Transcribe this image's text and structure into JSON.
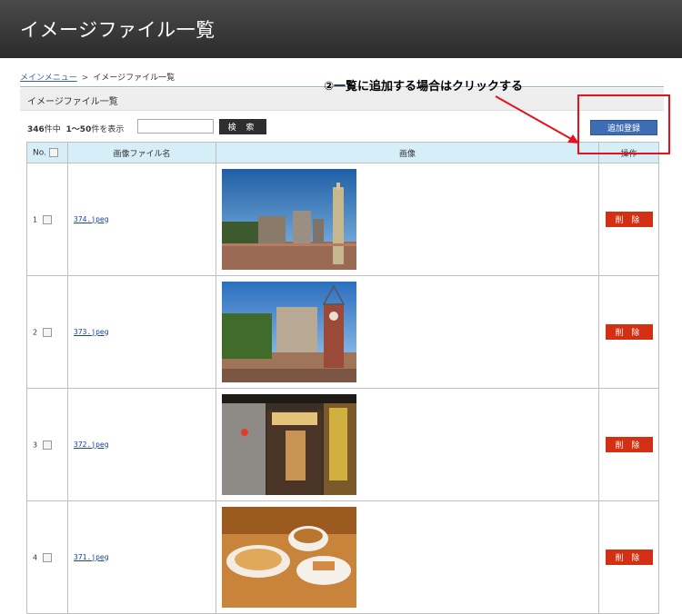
{
  "header": {
    "title": "イメージファイル一覧"
  },
  "breadcrumb": {
    "home": "メインメニュー",
    "separator": ">",
    "current": "イメージファイル一覧"
  },
  "section": {
    "title": "イメージファイル一覧"
  },
  "annotation": {
    "text": "②一覧に追加する場合はクリックする",
    "color": "#e8111b"
  },
  "listing": {
    "total": "346",
    "total_suffix": "件中",
    "range": "1～50",
    "range_suffix": "件を表示"
  },
  "search": {
    "value": "",
    "button_label": "検 索"
  },
  "toolbar": {
    "add_label": "追加登録"
  },
  "table": {
    "headers": {
      "no": "No.",
      "filename": "画像ファイル名",
      "image": "画像",
      "action": "操作"
    },
    "rows": [
      {
        "no": "1",
        "filename": "374.jpeg",
        "delete_label": "削 除",
        "image": "park-plaza-photo"
      },
      {
        "no": "2",
        "filename": "373.jpeg",
        "delete_label": "削 除",
        "image": "clock-tower-photo"
      },
      {
        "no": "3",
        "filename": "372.jpeg",
        "delete_label": "削 除",
        "image": "restaurant-entrance-photo"
      },
      {
        "no": "4",
        "filename": "371.jpeg",
        "delete_label": "削 除",
        "image": "food-plate-photo"
      }
    ]
  },
  "colors": {
    "header_bg": "#2b2b2b",
    "add_button": "#3f6db3",
    "delete_button": "#d42f12",
    "table_header": "#d6eef8"
  }
}
